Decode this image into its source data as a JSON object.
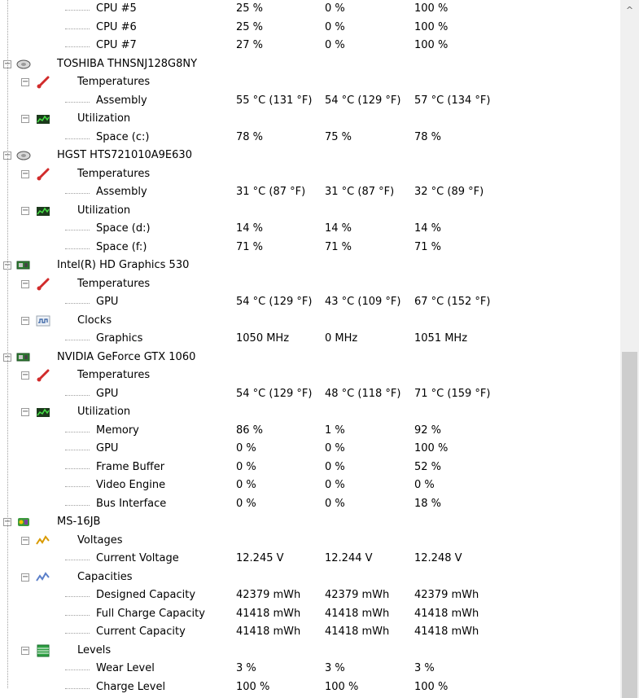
{
  "rows": [
    {
      "level": 2,
      "label": "CPU #5",
      "v": [
        "25 %",
        "0 %",
        "100 %"
      ]
    },
    {
      "level": 2,
      "label": "CPU #6",
      "v": [
        "25 %",
        "0 %",
        "100 %"
      ]
    },
    {
      "level": 2,
      "label": "CPU #7",
      "v": [
        "27 %",
        "0 %",
        "100 %"
      ]
    },
    {
      "level": 0,
      "label": "TOSHIBA THNSNJ128G8NY",
      "icon": "hard-drive-icon"
    },
    {
      "level": 1,
      "label": "Temperatures",
      "icon": "thermometer-icon"
    },
    {
      "level": 2,
      "label": "Assembly",
      "v": [
        "55 °C  (131 °F)",
        "54 °C  (129 °F)",
        "57 °C  (134 °F)"
      ]
    },
    {
      "level": 1,
      "label": "Utilization",
      "icon": "utilization-icon"
    },
    {
      "level": 2,
      "label": "Space (c:)",
      "v": [
        "78 %",
        "75 %",
        "78 %"
      ]
    },
    {
      "level": 0,
      "label": "HGST HTS721010A9E630",
      "icon": "hard-drive-icon"
    },
    {
      "level": 1,
      "label": "Temperatures",
      "icon": "thermometer-icon"
    },
    {
      "level": 2,
      "label": "Assembly",
      "v": [
        "31 °C  (87 °F)",
        "31 °C  (87 °F)",
        "32 °C  (89 °F)"
      ]
    },
    {
      "level": 1,
      "label": "Utilization",
      "icon": "utilization-icon"
    },
    {
      "level": 2,
      "label": "Space (d:)",
      "v": [
        "14 %",
        "14 %",
        "14 %"
      ]
    },
    {
      "level": 2,
      "label": "Space (f:)",
      "v": [
        "71 %",
        "71 %",
        "71 %"
      ]
    },
    {
      "level": 0,
      "label": "Intel(R) HD Graphics 530",
      "icon": "graphics-card-icon"
    },
    {
      "level": 1,
      "label": "Temperatures",
      "icon": "thermometer-icon"
    },
    {
      "level": 2,
      "label": "GPU",
      "v": [
        "54 °C  (129 °F)",
        "43 °C  (109 °F)",
        "67 °C  (152 °F)"
      ]
    },
    {
      "level": 1,
      "label": "Clocks",
      "icon": "clock-wave-icon"
    },
    {
      "level": 2,
      "label": "Graphics",
      "v": [
        "1050 MHz",
        "0 MHz",
        "1051 MHz"
      ]
    },
    {
      "level": 0,
      "label": "NVIDIA GeForce GTX 1060",
      "icon": "graphics-card-icon"
    },
    {
      "level": 1,
      "label": "Temperatures",
      "icon": "thermometer-icon"
    },
    {
      "level": 2,
      "label": "GPU",
      "v": [
        "54 °C  (129 °F)",
        "48 °C  (118 °F)",
        "71 °C  (159 °F)"
      ]
    },
    {
      "level": 1,
      "label": "Utilization",
      "icon": "utilization-icon"
    },
    {
      "level": 2,
      "label": "Memory",
      "v": [
        "86 %",
        "1 %",
        "92 %"
      ]
    },
    {
      "level": 2,
      "label": "GPU",
      "v": [
        "0 %",
        "0 %",
        "100 %"
      ]
    },
    {
      "level": 2,
      "label": "Frame Buffer",
      "v": [
        "0 %",
        "0 %",
        "52 %"
      ]
    },
    {
      "level": 2,
      "label": "Video Engine",
      "v": [
        "0 %",
        "0 %",
        "0 %"
      ]
    },
    {
      "level": 2,
      "label": "Bus Interface",
      "v": [
        "0 %",
        "0 %",
        "18 %"
      ]
    },
    {
      "level": 0,
      "label": "MS-16JB",
      "icon": "motherboard-icon"
    },
    {
      "level": 1,
      "label": "Voltages",
      "icon": "voltage-icon"
    },
    {
      "level": 2,
      "label": "Current Voltage",
      "v": [
        "12.245 V",
        "12.244 V",
        "12.248 V"
      ]
    },
    {
      "level": 1,
      "label": "Capacities",
      "icon": "capacity-icon"
    },
    {
      "level": 2,
      "label": "Designed Capacity",
      "v": [
        "42379 mWh",
        "42379 mWh",
        "42379 mWh"
      ]
    },
    {
      "level": 2,
      "label": "Full Charge Capacity",
      "v": [
        "41418 mWh",
        "41418 mWh",
        "41418 mWh"
      ]
    },
    {
      "level": 2,
      "label": "Current Capacity",
      "v": [
        "41418 mWh",
        "41418 mWh",
        "41418 mWh"
      ]
    },
    {
      "level": 1,
      "label": "Levels",
      "icon": "levels-icon"
    },
    {
      "level": 2,
      "label": "Wear Level",
      "v": [
        "3 %",
        "3 %",
        "3 %"
      ]
    },
    {
      "level": 2,
      "label": "Charge Level",
      "v": [
        "100 %",
        "100 %",
        "100 %"
      ]
    }
  ],
  "colors": {
    "alt_row": "#f0f0f0",
    "tree_line": "#a0a0a0",
    "scroll_thumb": "#cdcdcd"
  },
  "scrollbar": {
    "up_arrow_icon": "chevron-up-icon"
  }
}
